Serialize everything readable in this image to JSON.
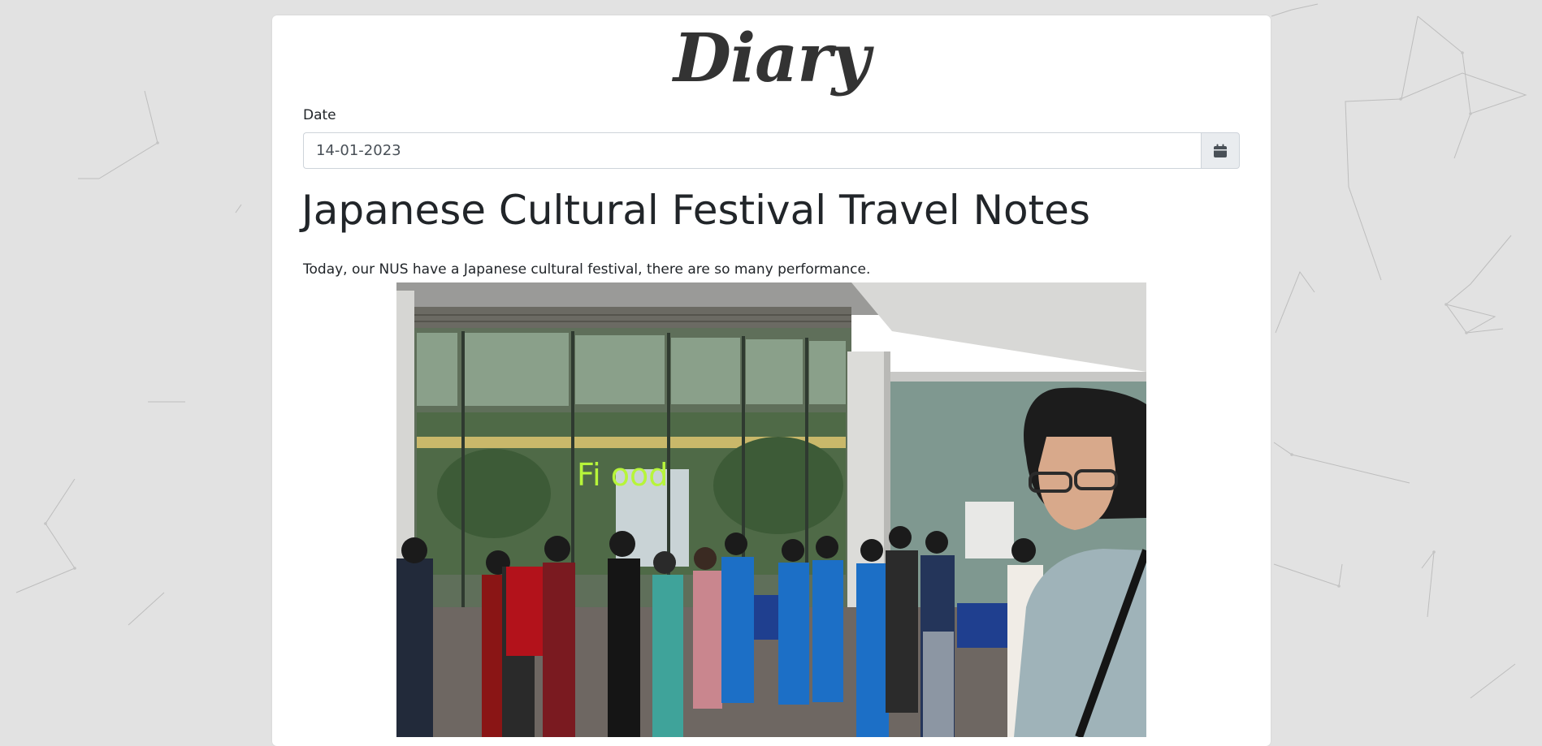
{
  "app": {
    "brand": "Diary"
  },
  "form": {
    "date_label": "Date",
    "date_value": "14-01-2023",
    "calendar_icon": "calendar-icon"
  },
  "entry": {
    "title": "Japanese Cultural Festival Travel Notes",
    "body": "Today, our NUS have a Japanese cultural festival, there are so many performance.",
    "photo": {
      "sign_text": "Fi   ood"
    }
  }
}
